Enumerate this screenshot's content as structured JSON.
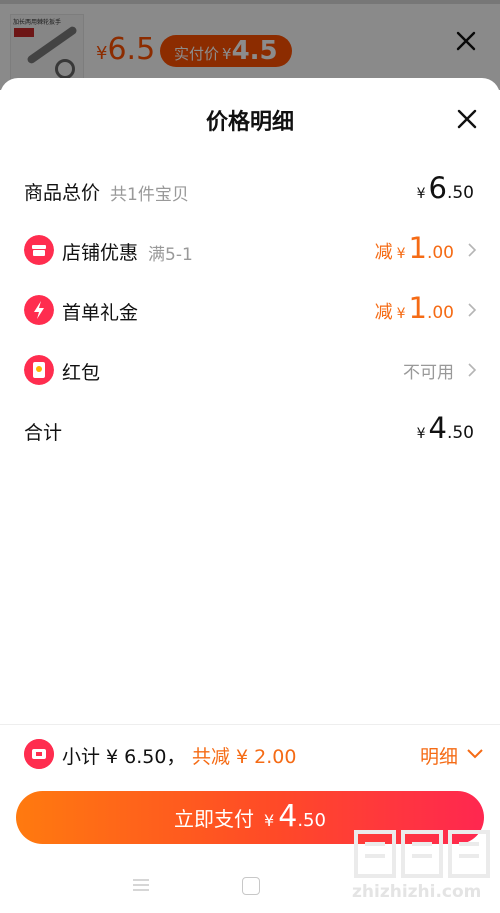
{
  "product_bar": {
    "thumb_caption": "加长两用棘轮扳手",
    "price_symbol": "¥",
    "price": "6.5",
    "actual_label": "实付价",
    "actual_symbol": "¥",
    "actual_price": "4.5"
  },
  "sheet": {
    "title": "价格明细",
    "rows": [
      {
        "label": "商品总价",
        "sub": "共1件宝贝",
        "symbol": "¥",
        "int": "6",
        "dec": ".50"
      },
      {
        "label": "店铺优惠",
        "sub": "满5-1",
        "prefix": "减",
        "symbol": "¥",
        "int": "1",
        "dec": ".00",
        "icon": "shop-icon"
      },
      {
        "label": "首单礼金",
        "prefix": "减",
        "symbol": "¥",
        "int": "1",
        "dec": ".00",
        "icon": "lightning-icon"
      },
      {
        "label": "红包",
        "value": "不可用",
        "icon": "red-packet-icon"
      },
      {
        "label": "合计",
        "symbol": "¥",
        "int": "4",
        "dec": ".50"
      }
    ]
  },
  "footer": {
    "subtotal": "小计 ¥ 6.50，",
    "savings": "共减 ¥ 2.00",
    "details": "明细",
    "pay_label": "立即支付",
    "pay_symbol": "¥",
    "pay_int": "4",
    "pay_dec": ".50"
  },
  "watermark": "zhizhizhi.com",
  "colors": {
    "accent": "#ff5000",
    "discount": "#f56b15",
    "icon_red": "#ff2d4f",
    "muted": "#999999"
  }
}
